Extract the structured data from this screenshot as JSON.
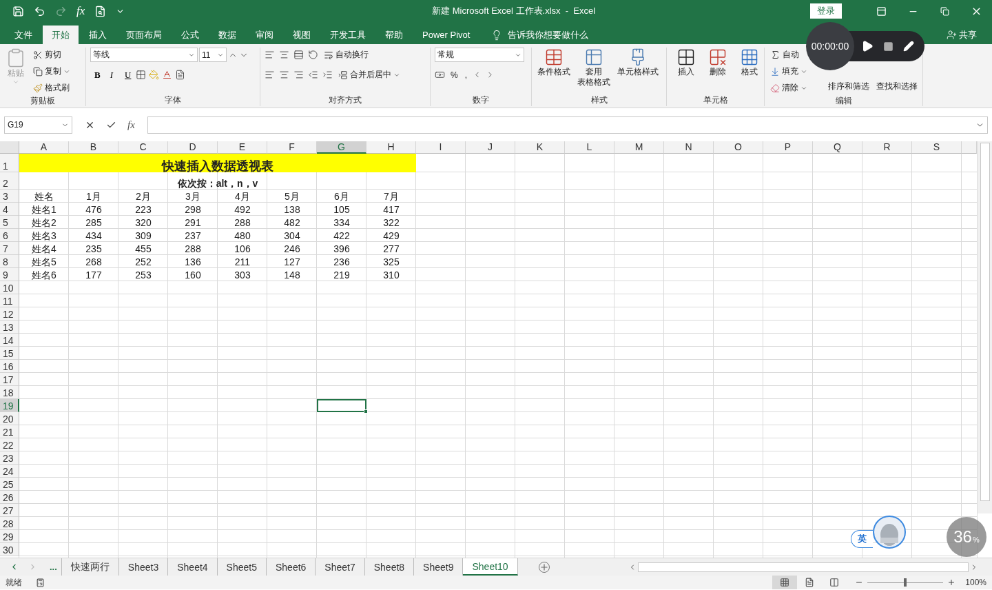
{
  "title_bar": {
    "quick_fx": "fx",
    "title": "新建 Microsoft Excel 工作表.xlsx  -  Excel",
    "login": "登录"
  },
  "menu_tabs": [
    {
      "label": "文件",
      "selected": false
    },
    {
      "label": "开始",
      "selected": true
    },
    {
      "label": "插入",
      "selected": false
    },
    {
      "label": "页面布局",
      "selected": false
    },
    {
      "label": "公式",
      "selected": false
    },
    {
      "label": "数据",
      "selected": false
    },
    {
      "label": "审阅",
      "selected": false
    },
    {
      "label": "视图",
      "selected": false
    },
    {
      "label": "开发工具",
      "selected": false
    },
    {
      "label": "帮助",
      "selected": false
    },
    {
      "label": "Power Pivot",
      "selected": false
    }
  ],
  "tell_me": "告诉我你想要做什么",
  "share": "共享",
  "ribbon": {
    "clipboard": {
      "label": "剪贴板",
      "paste": "粘贴",
      "cut": "剪切",
      "copy": "复制",
      "format_painter": "格式刷"
    },
    "font": {
      "label": "字体",
      "font_name": "等线",
      "font_size": "11",
      "bold": "B",
      "italic": "I",
      "underline": "U"
    },
    "alignment": {
      "label": "对齐方式",
      "wrap_text": "自动换行",
      "merge_center": "合并后居中"
    },
    "number": {
      "label": "数字",
      "format": "常规",
      "percent": "%",
      "comma": ","
    },
    "styles": {
      "label": "样式",
      "conditional": "条件格式",
      "table_format": [
        "套用",
        "表格格式"
      ],
      "cell_styles": "单元格样式"
    },
    "cells": {
      "label": "单元格",
      "insert": "插入",
      "delete": "删除",
      "format": "格式"
    },
    "editing": {
      "label": "编辑",
      "autosum": "自动",
      "fill": "填充",
      "clear": "清除",
      "sort_filter": "排序和筛选",
      "find_select": "查找和选择"
    }
  },
  "recorder": {
    "time": "00:00:00"
  },
  "formula_bar": {
    "name_box": "G19",
    "fx": "fx"
  },
  "sheet": {
    "columns": [
      {
        "label": "A",
        "selected": false
      },
      {
        "label": "B",
        "selected": false
      },
      {
        "label": "C",
        "selected": false
      },
      {
        "label": "D",
        "selected": false
      },
      {
        "label": "E",
        "selected": false
      },
      {
        "label": "F",
        "selected": false
      },
      {
        "label": "G",
        "selected": true
      },
      {
        "label": "H",
        "selected": false
      },
      {
        "label": "I",
        "selected": false
      },
      {
        "label": "J",
        "selected": false
      },
      {
        "label": "K",
        "selected": false
      },
      {
        "label": "L",
        "selected": false
      },
      {
        "label": "M",
        "selected": false
      },
      {
        "label": "N",
        "selected": false
      },
      {
        "label": "O",
        "selected": false
      },
      {
        "label": "P",
        "selected": false
      },
      {
        "label": "Q",
        "selected": false
      },
      {
        "label": "R",
        "selected": false
      },
      {
        "label": "S",
        "selected": false
      }
    ],
    "rows": [
      {
        "number": "1",
        "kind": "title",
        "selected": false,
        "cells": [
          "快速插入数据透视表"
        ]
      },
      {
        "number": "2",
        "kind": "subtitle",
        "selected": false,
        "cells": [
          "依次按：alt，n，v"
        ]
      },
      {
        "number": "3",
        "kind": "data",
        "selected": false,
        "cells": [
          "姓名",
          "1月",
          "2月",
          "3月",
          "4月",
          "5月",
          "6月",
          "7月"
        ]
      },
      {
        "number": "4",
        "kind": "data",
        "selected": false,
        "cells": [
          "姓名1",
          "476",
          "223",
          "298",
          "492",
          "138",
          "105",
          "417"
        ]
      },
      {
        "number": "5",
        "kind": "data",
        "selected": false,
        "cells": [
          "姓名2",
          "285",
          "320",
          "291",
          "288",
          "482",
          "334",
          "322"
        ]
      },
      {
        "number": "6",
        "kind": "data",
        "selected": false,
        "cells": [
          "姓名3",
          "434",
          "309",
          "237",
          "480",
          "304",
          "422",
          "429"
        ]
      },
      {
        "number": "7",
        "kind": "data",
        "selected": false,
        "cells": [
          "姓名4",
          "235",
          "455",
          "288",
          "106",
          "246",
          "396",
          "277"
        ]
      },
      {
        "number": "8",
        "kind": "data",
        "selected": false,
        "cells": [
          "姓名5",
          "268",
          "252",
          "136",
          "211",
          "127",
          "236",
          "325"
        ]
      },
      {
        "number": "9",
        "kind": "data",
        "selected": false,
        "cells": [
          "姓名6",
          "177",
          "253",
          "160",
          "303",
          "148",
          "219",
          "310"
        ]
      },
      {
        "number": "10",
        "kind": "data",
        "selected": false
      },
      {
        "number": "11",
        "kind": "data",
        "selected": false
      },
      {
        "number": "12",
        "kind": "data",
        "selected": false
      },
      {
        "number": "13",
        "kind": "data",
        "selected": false
      },
      {
        "number": "14",
        "kind": "data",
        "selected": false
      },
      {
        "number": "15",
        "kind": "data",
        "selected": false
      },
      {
        "number": "16",
        "kind": "data",
        "selected": false
      },
      {
        "number": "17",
        "kind": "data",
        "selected": false
      },
      {
        "number": "18",
        "kind": "data",
        "selected": false
      },
      {
        "number": "19",
        "kind": "data",
        "selected": true
      },
      {
        "number": "20",
        "kind": "data",
        "selected": false
      },
      {
        "number": "21",
        "kind": "data",
        "selected": false
      },
      {
        "number": "22",
        "kind": "data",
        "selected": false
      },
      {
        "number": "23",
        "kind": "data",
        "selected": false
      },
      {
        "number": "24",
        "kind": "data",
        "selected": false
      },
      {
        "number": "25",
        "kind": "data",
        "selected": false
      },
      {
        "number": "26",
        "kind": "data",
        "selected": false
      },
      {
        "number": "27",
        "kind": "data",
        "selected": false
      },
      {
        "number": "28",
        "kind": "data",
        "selected": false
      },
      {
        "number": "29",
        "kind": "data",
        "selected": false
      },
      {
        "number": "30",
        "kind": "data",
        "selected": false
      }
    ]
  },
  "sheet_tabs": {
    "overflow": "...",
    "tabs": [
      {
        "label": "快速两行",
        "selected": false
      },
      {
        "label": "Sheet3",
        "selected": false
      },
      {
        "label": "Sheet4",
        "selected": false
      },
      {
        "label": "Sheet5",
        "selected": false
      },
      {
        "label": "Sheet6",
        "selected": false
      },
      {
        "label": "Sheet7",
        "selected": false
      },
      {
        "label": "Sheet8",
        "selected": false
      },
      {
        "label": "Sheet9",
        "selected": false
      },
      {
        "label": "Sheet10",
        "selected": true
      }
    ]
  },
  "status_bar": {
    "status": "就绪",
    "zoom_slider": {
      "level": 0.5
    },
    "zoom": "100%"
  },
  "overlays": {
    "ime": "英",
    "meter": "36",
    "meter_unit": "%"
  }
}
